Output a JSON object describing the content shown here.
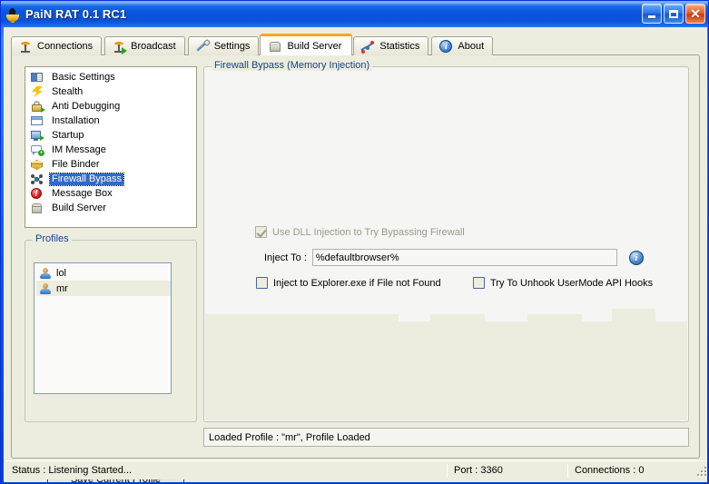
{
  "window": {
    "title": "PaiN RAT 0.1 RC1",
    "app_icon": "flame-torch-icon",
    "minimize_label": "",
    "maximize_label": "",
    "close_label": "✕"
  },
  "tabs": [
    {
      "label": "Connections",
      "icon": "antenna-icon",
      "active": false
    },
    {
      "label": "Broadcast",
      "icon": "broadcast-icon",
      "active": false
    },
    {
      "label": "Settings",
      "icon": "wrench-icon",
      "active": false
    },
    {
      "label": "Build Server",
      "icon": "box-icon",
      "active": true
    },
    {
      "label": "Statistics",
      "icon": "chart-icon",
      "active": false
    },
    {
      "label": "About",
      "icon": "info-icon",
      "active": false
    }
  ],
  "pages_list": {
    "selected": "Firewall Bypass",
    "items": [
      {
        "label": "Basic Settings",
        "icon": "window-settings-icon"
      },
      {
        "label": "Stealth",
        "icon": "lightning-bolt-icon"
      },
      {
        "label": "Anti Debugging",
        "icon": "padlock-icon"
      },
      {
        "label": "Installation",
        "icon": "blue-window-icon"
      },
      {
        "label": "Startup",
        "icon": "monitor-arrow-icon"
      },
      {
        "label": "IM Message",
        "icon": "speech-bubble-icon"
      },
      {
        "label": "File Binder",
        "icon": "yellow-box-icon"
      },
      {
        "label": "Firewall Bypass",
        "icon": "firewall-network-icon"
      },
      {
        "label": "Message Box",
        "icon": "red-exclamation-icon"
      },
      {
        "label": "Build Server",
        "icon": "gray-box-icon"
      }
    ]
  },
  "profiles": {
    "legend": "Profiles",
    "items": [
      {
        "label": "lol",
        "icon": "user-icon",
        "highlighted": false
      },
      {
        "label": "mr",
        "icon": "user-icon",
        "highlighted": true
      }
    ],
    "save_button": "Save Current Profile"
  },
  "firewall": {
    "legend": "Firewall Bypass (Memory Injection)",
    "use_dll_injection": {
      "label": "Use DLL Injection to Try Bypassing Firewall",
      "checked": true,
      "disabled": true
    },
    "inject_to": {
      "label": "Inject To :",
      "value": "%defaultbrowser%",
      "placeholder": ""
    },
    "info_icon": "info-icon",
    "inject_explorer": {
      "label": "Inject to Explorer.exe if File not Found",
      "checked": false
    },
    "unhook_api": {
      "label": "Try To Unhook UserMode API Hooks",
      "checked": false
    }
  },
  "log": {
    "text": "Loaded Profile : \"mr\", Profile Loaded"
  },
  "statusbar": {
    "status": "Status : Listening Started...",
    "port": "Port : 3360",
    "connections": "Connections : 0"
  },
  "colors": {
    "titlebar_blue": "#0a55dd",
    "legend_text": "#15428b",
    "selection_blue": "#316ac5",
    "face": "#ECEDDE",
    "active_tab_top": "#f5a623"
  }
}
